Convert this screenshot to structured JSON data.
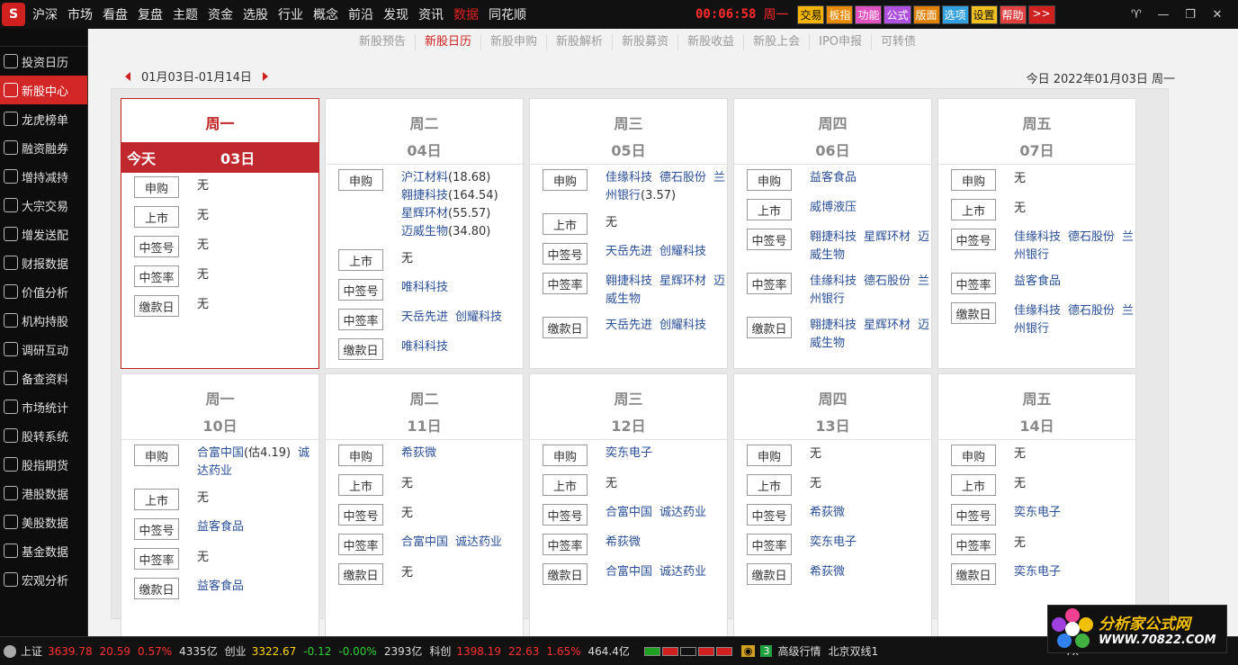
{
  "topbar": {
    "logo": "S",
    "menu": [
      "沪深",
      "市场",
      "看盘",
      "复盘",
      "主题",
      "资金",
      "选股",
      "行业",
      "概念",
      "前沿",
      "发现",
      "资讯",
      "数据",
      "同花顺"
    ],
    "active_menu": "数据",
    "clock": "00:06:58",
    "weekday": "周一",
    "quick_buttons": [
      "交易",
      "板指",
      "功能",
      "公式",
      "版面",
      "选项",
      "设置",
      "帮助",
      ">>"
    ],
    "window_controls": [
      "♈",
      "—",
      "❐",
      "✕"
    ]
  },
  "leftnav": {
    "items": [
      "投资日历",
      "新股中心",
      "龙虎榜单",
      "融资融券",
      "增持减持",
      "大宗交易",
      "增发送配",
      "财报数据",
      "价值分析",
      "机构持股",
      "调研互动",
      "备查资料",
      "市场统计",
      "股转系统",
      "股指期货",
      "港股数据",
      "美股数据",
      "基金数据",
      "宏观分析"
    ],
    "active": "新股中心"
  },
  "subtabs": {
    "items": [
      "新股预告",
      "新股日历",
      "新股申购",
      "新股解析",
      "新股募资",
      "新股收益",
      "新股上会",
      "IPO申报",
      "可转债"
    ],
    "active": "新股日历"
  },
  "calendar": {
    "range": "01月03日-01月14日",
    "today_text": "今日 2022年01月03日 周一",
    "today_label": "今天",
    "none": "无",
    "tags": {
      "subscribe": "申购",
      "listing": "上市",
      "lottery": "中签号",
      "rate": "中签率",
      "payment": "缴款日"
    },
    "days": [
      {
        "name": "周一",
        "date": "03日",
        "is_today": true,
        "subscribe": [],
        "listing": [],
        "lottery": [],
        "rate": [],
        "payment": []
      },
      {
        "name": "周二",
        "date": "04日",
        "is_today": false,
        "subscribe": [
          [
            "沪江材料",
            "(18.68)"
          ],
          [
            "翱捷科技",
            "(164.54)"
          ],
          [
            "星辉环材",
            "(55.57)"
          ],
          [
            "迈威生物",
            "(34.80)"
          ]
        ],
        "listing": [],
        "lottery": [
          [
            "唯科科技",
            ""
          ]
        ],
        "rate": [
          [
            "天岳先进",
            ""
          ],
          [
            "创耀科技",
            ""
          ]
        ],
        "payment": [
          [
            "唯科科技",
            ""
          ]
        ]
      },
      {
        "name": "周三",
        "date": "05日",
        "is_today": false,
        "subscribe": [
          [
            "佳缘科技",
            ""
          ],
          [
            "德石股份",
            ""
          ],
          [
            "兰州银行",
            "(3.57)"
          ]
        ],
        "listing": [],
        "lottery": [
          [
            "天岳先进",
            ""
          ],
          [
            "创耀科技",
            ""
          ]
        ],
        "rate": [
          [
            "翱捷科技",
            ""
          ],
          [
            "星辉环材",
            ""
          ],
          [
            "迈威生物",
            ""
          ]
        ],
        "payment": [
          [
            "天岳先进",
            ""
          ],
          [
            "创耀科技",
            ""
          ]
        ]
      },
      {
        "name": "周四",
        "date": "06日",
        "is_today": false,
        "subscribe": [
          [
            "益客食品",
            ""
          ]
        ],
        "listing": [
          [
            "威博液压",
            ""
          ]
        ],
        "lottery": [
          [
            "翱捷科技",
            ""
          ],
          [
            "星辉环材",
            ""
          ],
          [
            "迈威生物",
            ""
          ]
        ],
        "rate": [
          [
            "佳缘科技",
            ""
          ],
          [
            "德石股份",
            ""
          ],
          [
            "兰州银行",
            ""
          ]
        ],
        "payment": [
          [
            "翱捷科技",
            ""
          ],
          [
            "星辉环材",
            ""
          ],
          [
            "迈威生物",
            ""
          ]
        ]
      },
      {
        "name": "周五",
        "date": "07日",
        "is_today": false,
        "subscribe": [],
        "listing": [],
        "lottery": [
          [
            "佳缘科技",
            ""
          ],
          [
            "德石股份",
            ""
          ],
          [
            "兰州银行",
            ""
          ]
        ],
        "rate": [
          [
            "益客食品",
            ""
          ]
        ],
        "payment": [
          [
            "佳缘科技",
            ""
          ],
          [
            "德石股份",
            ""
          ],
          [
            "兰州银行",
            ""
          ]
        ]
      },
      {
        "name": "周一",
        "date": "10日",
        "is_today": false,
        "subscribe": [
          [
            "合富中国",
            "(估4.19)"
          ],
          [
            "诚达药业",
            ""
          ]
        ],
        "listing": [],
        "lottery": [
          [
            "益客食品",
            ""
          ]
        ],
        "rate": [],
        "payment": [
          [
            "益客食品",
            ""
          ]
        ]
      },
      {
        "name": "周二",
        "date": "11日",
        "is_today": false,
        "subscribe": [
          [
            "希荻微",
            ""
          ]
        ],
        "listing": [],
        "lottery": [],
        "rate": [
          [
            "合富中国",
            ""
          ],
          [
            "诚达药业",
            ""
          ]
        ],
        "payment": []
      },
      {
        "name": "周三",
        "date": "12日",
        "is_today": false,
        "subscribe": [
          [
            "奕东电子",
            ""
          ]
        ],
        "listing": [],
        "lottery": [
          [
            "合富中国",
            ""
          ],
          [
            "诚达药业",
            ""
          ]
        ],
        "rate": [
          [
            "希荻微",
            ""
          ]
        ],
        "payment": [
          [
            "合富中国",
            ""
          ],
          [
            "诚达药业",
            ""
          ]
        ]
      },
      {
        "name": "周四",
        "date": "13日",
        "is_today": false,
        "subscribe": [],
        "listing": [],
        "lottery": [
          [
            "希荻微",
            ""
          ]
        ],
        "rate": [
          [
            "奕东电子",
            ""
          ]
        ],
        "payment": [
          [
            "希荻微",
            ""
          ]
        ]
      },
      {
        "name": "周五",
        "date": "14日",
        "is_today": false,
        "subscribe": [],
        "listing": [],
        "lottery": [
          [
            "奕东电子",
            ""
          ]
        ],
        "rate": [],
        "payment": [
          [
            "奕东电子",
            ""
          ]
        ]
      }
    ]
  },
  "statusbar": {
    "sh_name": "上证",
    "sh_index": "3639.78",
    "sh_change": "20.59",
    "sh_pct": "0.57%",
    "sh_amount": "4335亿",
    "cy_name": "创业",
    "cy_index": "3322.67",
    "cy_change": "-0.12",
    "cy_pct": "-0.00%",
    "cy_amount": "2393亿",
    "kc_name": "科创",
    "kc_index": "1398.19",
    "kc_change": "22.63",
    "kc_pct": "1.65%",
    "kc_amount": "464.4亿",
    "badge_num": "3",
    "quote_level": "高级行情",
    "server": "北京双线1",
    "extra": "7x"
  },
  "brand": {
    "name": "分析家公式网",
    "url": "WWW.70822.COM"
  },
  "colors": {
    "accent": "#d32626",
    "link": "#2a4f9a",
    "up": "#ff3030",
    "down": "#30d030"
  }
}
